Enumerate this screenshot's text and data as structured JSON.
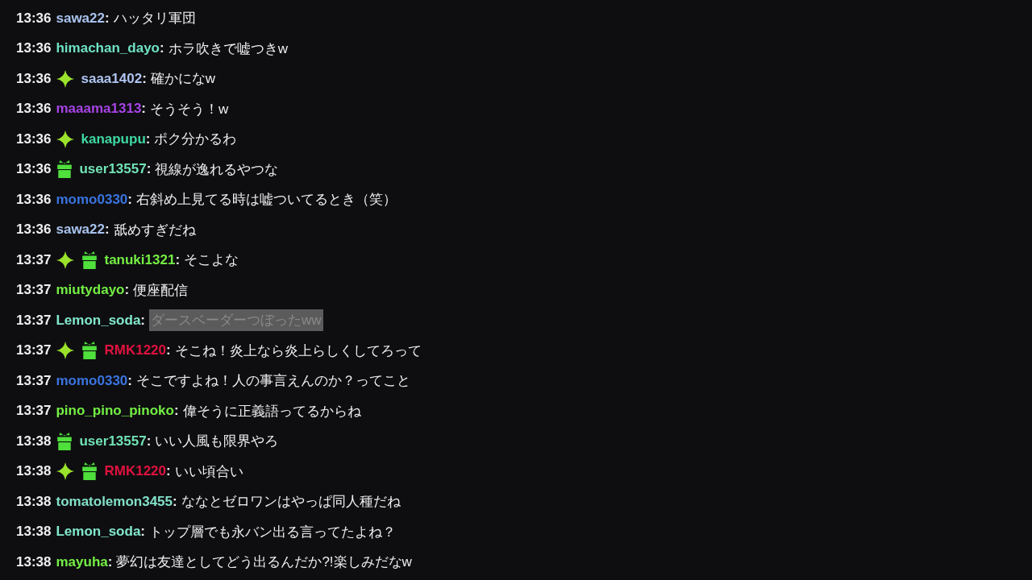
{
  "messages": [
    {
      "time": "13:36",
      "user": "sawa22",
      "color": "#a9c3ee",
      "colon": ":",
      "text": "ハッタリ軍団",
      "masked": false
    },
    {
      "time": "13:36",
      "user": "himachan_dayo",
      "color": "#6fe2c4",
      "colon": ":",
      "text": "ホラ吹きで嘘つきw",
      "masked": false
    },
    {
      "time": "13:36",
      "badges": [
        {
          "kind": "sparkle"
        }
      ],
      "user": "saaa1402",
      "color": "#afc4f2",
      "colon": ":",
      "text": "確かになw",
      "masked": false
    },
    {
      "time": "13:36",
      "user": "maaama1313",
      "color": "#a744e6",
      "colon": ":",
      "text": "そうそう！w",
      "masked": false
    },
    {
      "time": "13:36",
      "badges": [
        {
          "kind": "sparkle"
        }
      ],
      "user": "kanapupu",
      "color": "#3fd9a2",
      "colon": ":",
      "text": "ポク分かるわ",
      "masked": false
    },
    {
      "time": "13:36",
      "badges": [
        {
          "kind": "gift"
        }
      ],
      "user": "user13557",
      "color": "#72e3b6",
      "colon": ":",
      "text": "視線が逸れるやつな",
      "masked": false
    },
    {
      "time": "13:36",
      "user": "momo0330",
      "color": "#3a74e0",
      "colon": ":",
      "text": "右斜め上見てる時は嘘ついてるとき（笑）",
      "masked": false
    },
    {
      "time": "13:36",
      "user": "sawa22",
      "color": "#a9c3ee",
      "colon": ":",
      "text": "舐めすぎだね",
      "masked": false
    },
    {
      "time": "13:37",
      "badges": [
        {
          "kind": "sparkle"
        },
        {
          "kind": "gift"
        }
      ],
      "user": "tanuki1321",
      "color": "#74ef44",
      "colon": ":",
      "text": "そこよな",
      "masked": false
    },
    {
      "time": "13:37",
      "user": "miutydayo",
      "color": "#74ef44",
      "colon": ":",
      "text": "便座配信",
      "masked": false
    },
    {
      "time": "13:37",
      "user": "Lemon_soda",
      "color": "#82e8cc",
      "colon": ":",
      "text": "ダースベーダーつぼったww",
      "masked": true
    },
    {
      "time": "13:37",
      "badges": [
        {
          "kind": "sparkle"
        },
        {
          "kind": "gift"
        }
      ],
      "user": "RMK1220",
      "color": "#e0123f",
      "colon": ":",
      "text": "そこね！炎上なら炎上らしくしてろって",
      "masked": false
    },
    {
      "time": "13:37",
      "user": "momo0330",
      "color": "#3a74e0",
      "colon": ":",
      "text": "そこですよね！人の事言えんのか？ってこと",
      "masked": false
    },
    {
      "time": "13:37",
      "user": "pino_pino_pinoko",
      "color": "#74ef44",
      "colon": ":",
      "text": "偉そうに正義語ってるからね",
      "masked": false
    },
    {
      "time": "13:38",
      "badges": [
        {
          "kind": "gift"
        }
      ],
      "user": "user13557",
      "color": "#72e3b6",
      "colon": ":",
      "text": "いい人風も限界やろ",
      "masked": false
    },
    {
      "time": "13:38",
      "badges": [
        {
          "kind": "sparkle"
        },
        {
          "kind": "gift"
        }
      ],
      "user": "RMK1220",
      "color": "#e0123f",
      "colon": ":",
      "text": "いい頃合い",
      "masked": false
    },
    {
      "time": "13:38",
      "user": "tomatolemon3455",
      "color": "#82e0c8",
      "colon": ":",
      "text": "ななとゼロワンはやっぱ同人種だね",
      "masked": false
    },
    {
      "time": "13:38",
      "user": "Lemon_soda",
      "color": "#82e8cc",
      "colon": ":",
      "text": "トップ層でも永バン出る言ってたよね？",
      "masked": false
    },
    {
      "time": "13:38",
      "user": "mayuha",
      "color": "#74ef44",
      "colon": ":",
      "text": "夢幻は友達としてどう出るんだか?!楽しみだなw",
      "masked": false
    }
  ]
}
